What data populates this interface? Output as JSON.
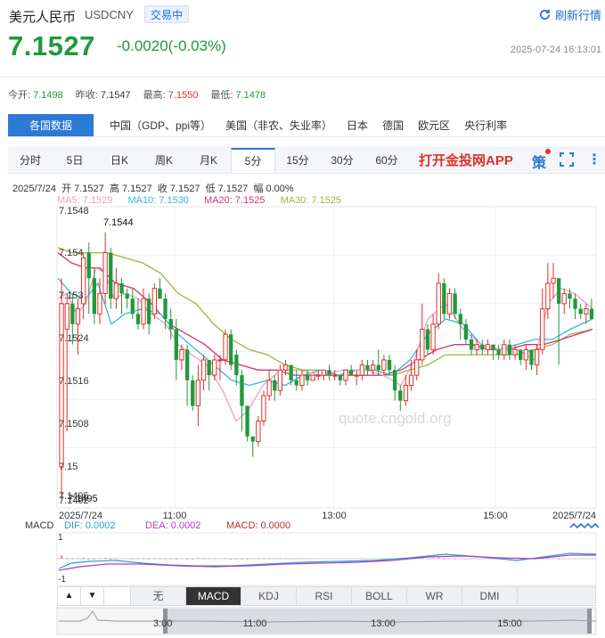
{
  "header": {
    "name": "美元人民币",
    "code": "USDCNY",
    "status_badge": "交易中",
    "refresh_label": "刷新行情",
    "price": "7.1527",
    "change": "-0.0020(-0.03%)",
    "timestamp": "2025-07-24 16:13:01"
  },
  "quote": {
    "open_label": "今开:",
    "open": "7.1498",
    "prev_label": "昨收:",
    "prev": "7.1547",
    "high_label": "最高:",
    "high": "7.1550",
    "low_label": "最低:",
    "low": "7.1478"
  },
  "data_tabs": [
    "各国数据",
    "中国（GDP、ppi等）",
    "美国（非农、失业率）",
    "日本",
    "德国",
    "欧元区",
    "央行利率"
  ],
  "period_tabs": [
    "分时",
    "5日",
    "日K",
    "周K",
    "月K",
    "5分",
    "15分",
    "30分",
    "60分"
  ],
  "active_period": "5分",
  "app_link": "打开金投网APP",
  "info": {
    "date": "2025/7/24",
    "open_label": "开",
    "open": "7.1527",
    "high_label": "高",
    "high": "7.1527",
    "close_label": "收",
    "close": "7.1527",
    "low_label": "低",
    "low": "7.1527",
    "amp_label": "幅",
    "amp": "0.00%",
    "ma5": "MA5: 7.1529",
    "ma10": "MA10: 7.1530",
    "ma20": "MA20: 7.1525",
    "ma30": "MA30: 7.1525"
  },
  "colors": {
    "up": "#e0302b",
    "down": "#1f9a3a",
    "accent": "#2d7ad4",
    "ma5": "#f19ec2",
    "ma10": "#35b8da",
    "ma20": "#d6337c",
    "ma30": "#9ab83c"
  },
  "chart_data": {
    "type": "candlestick",
    "y_ticks": [
      "7.1548",
      "7.154",
      "7.153",
      "7.1524",
      "7.1516",
      "7.1508",
      "7.15",
      "7.1495",
      "7.1492"
    ],
    "high_marker": "7.1544",
    "low_marker": "7.1495",
    "x_ticks": [
      "2025/7/24",
      "11:00",
      "13:00",
      "15:00",
      "2025/7/24"
    ],
    "watermark": "quote.cngold.org",
    "ylim": [
      7.149,
      7.1549
    ],
    "candles": [
      [
        7.1498,
        7.153,
        7.1535,
        7.1492
      ],
      [
        7.1525,
        7.153,
        7.1532,
        7.1505
      ],
      [
        7.153,
        7.1526,
        7.1532,
        7.1522
      ],
      [
        7.1526,
        7.1529,
        7.1531,
        7.152
      ],
      [
        7.153,
        7.1539,
        7.154,
        7.1527
      ],
      [
        7.154,
        7.1535,
        7.1542,
        7.1528
      ],
      [
        7.1535,
        7.1528,
        7.1537,
        7.1526
      ],
      [
        7.1528,
        7.1532,
        7.1535,
        7.1526
      ],
      [
        7.1532,
        7.154,
        7.1544,
        7.153
      ],
      [
        7.154,
        7.1531,
        7.1541,
        7.1529
      ],
      [
        7.1531,
        7.1534,
        7.1537,
        7.1529
      ],
      [
        7.1534,
        7.1532,
        7.1535,
        7.1528
      ],
      [
        7.1532,
        7.1531,
        7.1533,
        7.1529
      ],
      [
        7.1531,
        7.1528,
        7.1533,
        7.1527
      ],
      [
        7.1528,
        7.1526,
        7.1531,
        7.1525
      ],
      [
        7.1526,
        7.1531,
        7.1533,
        7.1525
      ],
      [
        7.1531,
        7.1526,
        7.1532,
        7.1524
      ],
      [
        7.1528,
        7.1533,
        7.1534,
        7.1527
      ],
      [
        7.1533,
        7.1531,
        7.1535,
        7.1531
      ],
      [
        7.1531,
        7.1527,
        7.1532,
        7.1525
      ],
      [
        7.1527,
        7.1525,
        7.1529,
        7.1523
      ],
      [
        7.1525,
        7.1519,
        7.1527,
        7.1515
      ],
      [
        7.1519,
        7.1521,
        7.1522,
        7.1517
      ],
      [
        7.1521,
        7.1515,
        7.1522,
        7.151
      ],
      [
        7.1515,
        7.151,
        7.1516,
        7.1509
      ],
      [
        7.151,
        7.1515,
        7.1518,
        7.1506
      ],
      [
        7.1515,
        7.1519,
        7.152,
        7.1513
      ],
      [
        7.1519,
        7.1516,
        7.1519,
        7.1513
      ],
      [
        7.1516,
        7.1519,
        7.152,
        7.1515
      ],
      [
        7.1519,
        7.1519,
        7.152,
        7.1515
      ],
      [
        7.1519,
        7.1524,
        7.1525,
        7.1518
      ],
      [
        7.1524,
        7.1518,
        7.1525,
        7.1517
      ],
      [
        7.152,
        7.1516,
        7.1521,
        7.1514
      ],
      [
        7.1516,
        7.151,
        7.1517,
        7.1505
      ],
      [
        7.151,
        7.1504,
        7.151,
        7.1503
      ],
      [
        7.1504,
        7.1503,
        7.1504,
        7.15
      ],
      [
        7.1503,
        7.1507,
        7.1508,
        7.1502
      ],
      [
        7.1507,
        7.1512,
        7.1513,
        7.1506
      ],
      [
        7.1512,
        7.1515,
        7.1517,
        7.1511
      ],
      [
        7.1515,
        7.1513,
        7.1516,
        7.1511
      ],
      [
        7.1513,
        7.1517,
        7.1518,
        7.1512
      ],
      [
        7.1517,
        7.1518,
        7.1519,
        7.1516
      ],
      [
        7.1518,
        7.1515,
        7.1518,
        7.1514
      ],
      [
        7.1515,
        7.1514,
        7.1517,
        7.1513
      ],
      [
        7.1514,
        7.1516,
        7.1517,
        7.1513
      ],
      [
        7.1516,
        7.1515,
        7.1517,
        7.1514
      ],
      [
        7.1515,
        7.1516,
        7.1516,
        7.1515
      ],
      [
        7.1516,
        7.1516,
        7.1517,
        7.1515
      ],
      [
        7.1516,
        7.1517,
        7.1517,
        7.1515
      ],
      [
        7.1517,
        7.1516,
        7.1518,
        7.1515
      ],
      [
        7.1516,
        7.1516,
        7.1517,
        7.1515
      ],
      [
        7.1516,
        7.1515,
        7.1516,
        7.1514
      ],
      [
        7.1515,
        7.1517,
        7.1517,
        7.1514
      ],
      [
        7.1517,
        7.1516,
        7.1518,
        7.1516
      ],
      [
        7.1516,
        7.1516,
        7.1517,
        7.1514
      ],
      [
        7.1516,
        7.1518,
        7.1519,
        7.1515
      ],
      [
        7.1518,
        7.1517,
        7.1519,
        7.1516
      ],
      [
        7.1517,
        7.1518,
        7.1519,
        7.1516
      ],
      [
        7.1518,
        7.1517,
        7.1521,
        7.1516
      ],
      [
        7.1517,
        7.1519,
        7.152,
        7.1516
      ],
      [
        7.1519,
        7.1517,
        7.152,
        7.1516
      ],
      [
        7.1517,
        7.1513,
        7.1518,
        7.1511
      ],
      [
        7.1513,
        7.1511,
        7.1514,
        7.1509
      ],
      [
        7.1511,
        7.1514,
        7.1516,
        7.151
      ],
      [
        7.1514,
        7.1516,
        7.1519,
        7.1513
      ],
      [
        7.1516,
        7.1519,
        7.1521,
        7.1515
      ],
      [
        7.1519,
        7.1525,
        7.153,
        7.1518
      ],
      [
        7.1525,
        7.1521,
        7.1526,
        7.152
      ],
      [
        7.1521,
        7.1526,
        7.1528,
        7.152
      ],
      [
        7.1526,
        7.1534,
        7.1536,
        7.1525
      ],
      [
        7.1534,
        7.1528,
        7.1535,
        7.1527
      ],
      [
        7.1528,
        7.1532,
        7.1533,
        7.1527
      ],
      [
        7.1532,
        7.1528,
        7.1533,
        7.1527
      ],
      [
        7.1528,
        7.1526,
        7.1529,
        7.1523
      ],
      [
        7.1526,
        7.1523,
        7.1527,
        7.1522
      ],
      [
        7.1523,
        7.1521,
        7.1524,
        7.152
      ],
      [
        7.1521,
        7.1522,
        7.1523,
        7.152
      ],
      [
        7.1522,
        7.1521,
        7.1523,
        7.152
      ],
      [
        7.1521,
        7.1522,
        7.1523,
        7.152
      ],
      [
        7.1522,
        7.1521,
        7.1522,
        7.1519
      ],
      [
        7.1521,
        7.152,
        7.1522,
        7.1519
      ],
      [
        7.152,
        7.1522,
        7.1523,
        7.1519
      ],
      [
        7.1522,
        7.152,
        7.1523,
        7.1519
      ],
      [
        7.152,
        7.1521,
        7.1522,
        7.1519
      ],
      [
        7.1521,
        7.1519,
        7.1521,
        7.1518
      ],
      [
        7.1519,
        7.1521,
        7.1522,
        7.1517
      ],
      [
        7.1521,
        7.1518,
        7.1521,
        7.1517
      ],
      [
        7.1518,
        7.1521,
        7.1522,
        7.1516
      ],
      [
        7.1521,
        7.1529,
        7.1533,
        7.152
      ],
      [
        7.1529,
        7.1534,
        7.1538,
        7.1527
      ],
      [
        7.1534,
        7.1535,
        7.1538,
        7.1531
      ],
      [
        7.1535,
        7.153,
        7.1535,
        7.1518
      ],
      [
        7.153,
        7.1532,
        7.1533,
        7.1528
      ],
      [
        7.1532,
        7.1531,
        7.1533,
        7.1529
      ],
      [
        7.1531,
        7.1529,
        7.1532,
        7.1527
      ],
      [
        7.1529,
        7.1528,
        7.153,
        7.1527
      ],
      [
        7.1528,
        7.1529,
        7.153,
        7.1526
      ],
      [
        7.1529,
        7.1527,
        7.1531,
        7.1527
      ]
    ],
    "ma5": [
      [
        65,
        7.1531
      ],
      [
        75,
        7.1532
      ],
      [
        86,
        7.1528
      ],
      [
        96,
        7.153
      ],
      [
        108,
        7.1537
      ],
      [
        118,
        7.1536
      ],
      [
        128,
        7.1531
      ],
      [
        140,
        7.1532
      ],
      [
        155,
        7.1531
      ],
      [
        170,
        7.1528
      ],
      [
        186,
        7.1526
      ],
      [
        200,
        7.1522
      ],
      [
        215,
        7.152
      ],
      [
        232,
        7.1518
      ],
      [
        250,
        7.1513
      ],
      [
        265,
        7.1507
      ],
      [
        278,
        7.1509
      ],
      [
        295,
        7.1514
      ],
      [
        315,
        7.1517
      ],
      [
        335,
        7.1517
      ],
      [
        360,
        7.1516
      ],
      [
        385,
        7.1517
      ],
      [
        410,
        7.1517
      ],
      [
        430,
        7.1516
      ],
      [
        450,
        7.1514
      ],
      [
        465,
        7.1519
      ],
      [
        480,
        7.1527
      ],
      [
        500,
        7.153
      ],
      [
        520,
        7.1525
      ],
      [
        540,
        7.1522
      ],
      [
        560,
        7.1521
      ],
      [
        580,
        7.1521
      ],
      [
        600,
        7.1519
      ],
      [
        615,
        7.153
      ],
      [
        630,
        7.1533
      ],
      [
        645,
        7.1532
      ],
      [
        665,
        7.1529
      ]
    ],
    "ma10": [
      [
        65,
        7.1535
      ],
      [
        80,
        7.1532
      ],
      [
        96,
        7.1531
      ],
      [
        110,
        7.1534
      ],
      [
        125,
        7.1526
      ],
      [
        140,
        7.1528
      ],
      [
        160,
        7.1529
      ],
      [
        180,
        7.1528
      ],
      [
        200,
        7.1524
      ],
      [
        220,
        7.1521
      ],
      [
        240,
        7.1518
      ],
      [
        260,
        7.1515
      ],
      [
        280,
        7.1514
      ],
      [
        300,
        7.1515
      ],
      [
        320,
        7.1514
      ],
      [
        340,
        7.1516
      ],
      [
        360,
        7.1517
      ],
      [
        380,
        7.1516
      ],
      [
        400,
        7.1517
      ],
      [
        420,
        7.1517
      ],
      [
        440,
        7.1516
      ],
      [
        460,
        7.1519
      ],
      [
        480,
        7.1524
      ],
      [
        500,
        7.1527
      ],
      [
        520,
        7.1526
      ],
      [
        540,
        7.1522
      ],
      [
        560,
        7.1521
      ],
      [
        580,
        7.1522
      ],
      [
        600,
        7.1523
      ],
      [
        620,
        7.1523
      ],
      [
        640,
        7.1525
      ],
      [
        665,
        7.1527
      ]
    ],
    "ma20": [
      [
        65,
        7.154
      ],
      [
        80,
        7.1538
      ],
      [
        96,
        7.1537
      ],
      [
        112,
        7.1537
      ],
      [
        130,
        7.1534
      ],
      [
        150,
        7.1533
      ],
      [
        170,
        7.153
      ],
      [
        190,
        7.1526
      ],
      [
        210,
        7.1524
      ],
      [
        230,
        7.1522
      ],
      [
        250,
        7.1519
      ],
      [
        270,
        7.1518
      ],
      [
        290,
        7.1517
      ],
      [
        310,
        7.1517
      ],
      [
        330,
        7.1516
      ],
      [
        350,
        7.1516
      ],
      [
        370,
        7.1516
      ],
      [
        390,
        7.1516
      ],
      [
        410,
        7.1516
      ],
      [
        430,
        7.1516
      ],
      [
        450,
        7.1517
      ],
      [
        470,
        7.1519
      ],
      [
        490,
        7.1521
      ],
      [
        510,
        7.1522
      ],
      [
        530,
        7.1522
      ],
      [
        550,
        7.1521
      ],
      [
        570,
        7.1521
      ],
      [
        590,
        7.1522
      ],
      [
        610,
        7.1522
      ],
      [
        630,
        7.1523
      ],
      [
        665,
        7.1525
      ]
    ],
    "ma30": [
      [
        65,
        7.1541
      ],
      [
        80,
        7.154
      ],
      [
        100,
        7.154
      ],
      [
        120,
        7.154
      ],
      [
        140,
        7.1539
      ],
      [
        160,
        7.1538
      ],
      [
        180,
        7.1536
      ],
      [
        200,
        7.1532
      ],
      [
        220,
        7.153
      ],
      [
        240,
        7.1526
      ],
      [
        260,
        7.1523
      ],
      [
        280,
        7.1521
      ],
      [
        300,
        7.152
      ],
      [
        320,
        7.1518
      ],
      [
        340,
        7.1517
      ],
      [
        360,
        7.1517
      ],
      [
        380,
        7.1516
      ],
      [
        400,
        7.1516
      ],
      [
        420,
        7.1516
      ],
      [
        440,
        7.1516
      ],
      [
        460,
        7.1517
      ],
      [
        480,
        7.1518
      ],
      [
        500,
        7.152
      ],
      [
        520,
        7.152
      ],
      [
        540,
        7.152
      ],
      [
        560,
        7.152
      ],
      [
        580,
        7.152
      ],
      [
        600,
        7.1521
      ],
      [
        620,
        7.1522
      ],
      [
        640,
        7.1524
      ],
      [
        665,
        7.1525
      ]
    ]
  },
  "macd": {
    "title": "MACD",
    "dif": "DIF: 0.0002",
    "dea": "DEA: 0.0002",
    "macd": "MACD: 0.0000",
    "axis_top": "1",
    "axis_bottom": "-1"
  },
  "indicator_tabs": [
    "无",
    "MACD",
    "KDJ",
    "RSI",
    "BOLL",
    "WR",
    "DMI"
  ],
  "active_indicator": "MACD",
  "nav_up": "▲",
  "nav_down": "▼",
  "navigator_ticks": [
    "3:00",
    "11:00",
    "13:00",
    "15:00"
  ]
}
